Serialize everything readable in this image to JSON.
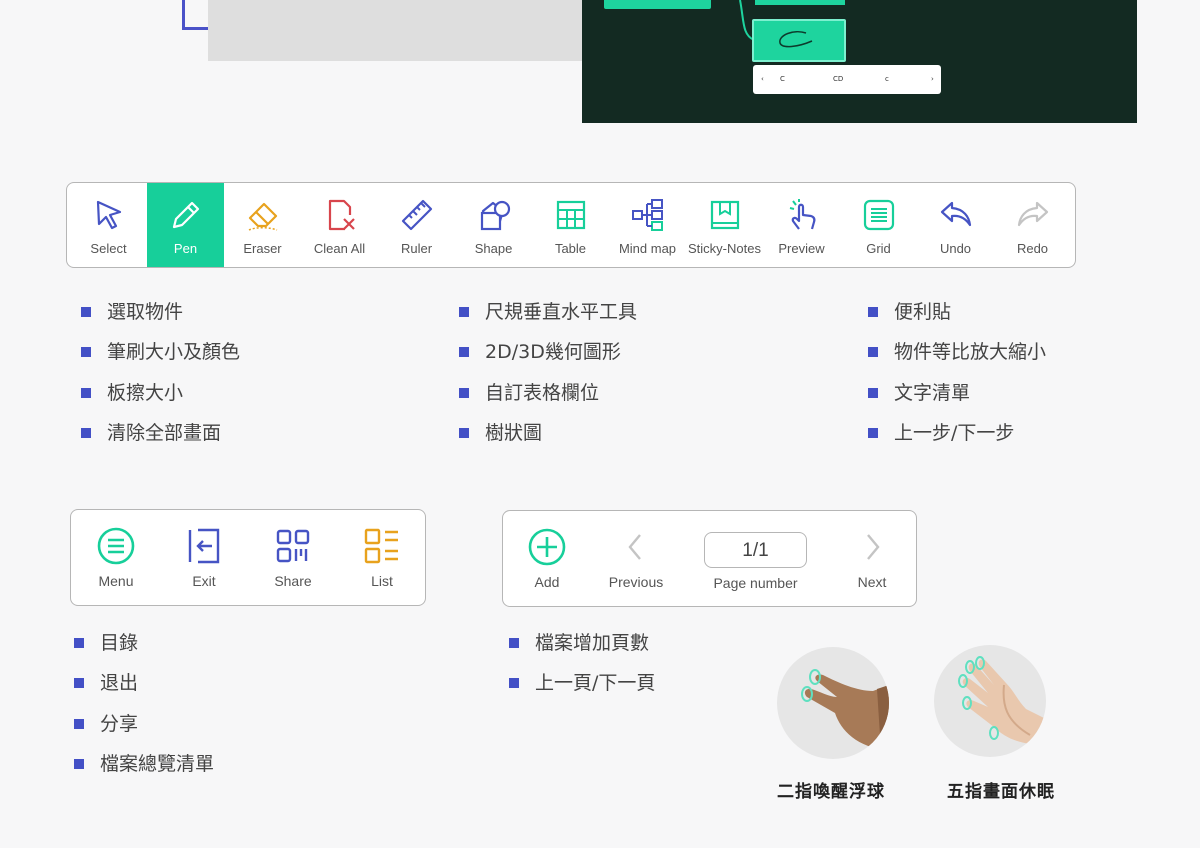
{
  "preview_toolbar": {
    "left": "‹",
    "c1": "C",
    "c2": "CD",
    "c3": "c",
    "right": "›"
  },
  "main_toolbar": {
    "tools": [
      {
        "label": "Select",
        "icon": "cursor-arrow-icon",
        "active": false
      },
      {
        "label": "Pen",
        "icon": "pen-icon",
        "active": true
      },
      {
        "label": "Eraser",
        "icon": "eraser-icon",
        "active": false
      },
      {
        "label": "Clean All",
        "icon": "clean-all-icon",
        "active": false
      },
      {
        "label": "Ruler",
        "icon": "ruler-icon",
        "active": false
      },
      {
        "label": "Shape",
        "icon": "shape-icon",
        "active": false
      },
      {
        "label": "Table",
        "icon": "table-icon",
        "active": false
      },
      {
        "label": "Mind map",
        "icon": "mind-map-icon",
        "active": false
      },
      {
        "label": "Sticky-Notes",
        "icon": "sticky-notes-icon",
        "active": false
      },
      {
        "label": "Preview",
        "icon": "preview-hand-icon",
        "active": false
      },
      {
        "label": "Grid",
        "icon": "grid-icon",
        "active": false
      },
      {
        "label": "Undo",
        "icon": "undo-icon",
        "active": false
      },
      {
        "label": "Redo",
        "icon": "redo-icon",
        "active": false
      }
    ]
  },
  "features_col1": [
    "選取物件",
    "筆刷大小及顏色",
    "板擦大小",
    "清除全部畫面"
  ],
  "features_col2": [
    "尺規垂直水平工具",
    "2D/3D幾何圖形",
    "自訂表格欄位",
    "樹狀圖"
  ],
  "features_col3": [
    "便利貼",
    "物件等比放大縮小",
    "文字清單",
    "上一步/下一步"
  ],
  "menu_toolbar": {
    "tools": [
      {
        "label": "Menu",
        "icon": "menu-icon"
      },
      {
        "label": "Exit",
        "icon": "exit-icon"
      },
      {
        "label": "Share",
        "icon": "qr-share-icon"
      },
      {
        "label": "List",
        "icon": "list-icon"
      }
    ]
  },
  "page_toolbar": {
    "add_label": "Add",
    "previous_label": "Previous",
    "page_value": "1/1",
    "page_label": "Page number",
    "next_label": "Next"
  },
  "menu_features": [
    "目錄",
    "退出",
    "分享",
    "檔案總覽清單"
  ],
  "page_features": [
    "檔案增加頁數",
    "上一頁/下一頁"
  ],
  "gestures": [
    {
      "caption": "二指喚醒浮球",
      "icon": "two-finger-hand-icon"
    },
    {
      "caption": "五指畫面休眠",
      "icon": "five-finger-hand-icon"
    }
  ],
  "colors": {
    "accent_green": "#17cf9a",
    "bullet_blue": "#4350c6",
    "dark_panel": "#132a22"
  }
}
